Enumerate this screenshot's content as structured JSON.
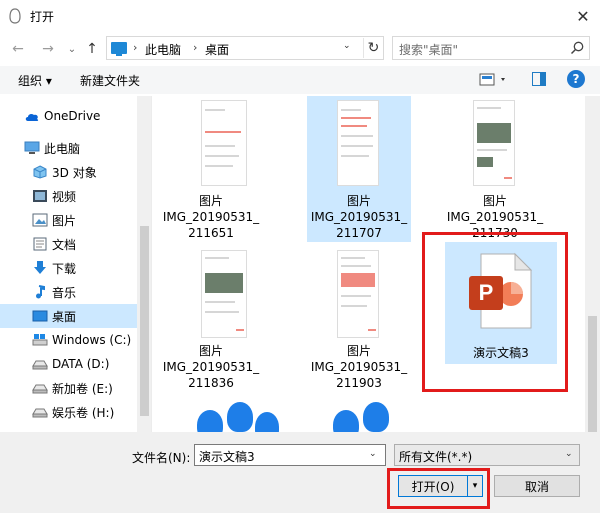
{
  "window": {
    "title": "打开",
    "close": "✕"
  },
  "nav": {
    "back": "←",
    "forward": "→",
    "recent": "⌄",
    "up": "↑",
    "sep": "›",
    "crumbs": [
      "此电脑",
      "桌面"
    ],
    "dropdown": "⌄",
    "refresh": "↻"
  },
  "search": {
    "placeholder": "搜索\"桌面\""
  },
  "toolbar": {
    "organize": "组织 ▾",
    "new_folder": "新建文件夹",
    "help": "?"
  },
  "sidebar": {
    "items": [
      {
        "label": "OneDrive",
        "icon": "cloud-icon"
      },
      {
        "label": "此电脑",
        "icon": "computer-icon"
      },
      {
        "label": "3D 对象",
        "icon": "cube-icon"
      },
      {
        "label": "视频",
        "icon": "video-icon"
      },
      {
        "label": "图片",
        "icon": "picture-icon"
      },
      {
        "label": "文档",
        "icon": "document-icon"
      },
      {
        "label": "下载",
        "icon": "download-icon"
      },
      {
        "label": "音乐",
        "icon": "music-icon"
      },
      {
        "label": "桌面",
        "icon": "desktop-icon",
        "selected": true
      },
      {
        "label": "Windows (C:)",
        "icon": "drive-icon"
      },
      {
        "label": "DATA (D:)",
        "icon": "drive-icon"
      },
      {
        "label": "新加卷 (E:)",
        "icon": "drive-icon"
      },
      {
        "label": "娱乐卷 (H:)",
        "icon": "drive-icon"
      }
    ]
  },
  "files": [
    {
      "line1": "图片",
      "line2": "IMG_20190531_",
      "line3": "211651"
    },
    {
      "line1": "图片",
      "line2": "IMG_20190531_",
      "line3": "211707"
    },
    {
      "line1": "图片",
      "line2": "IMG_20190531_",
      "line3": "211730"
    },
    {
      "line1": "图片",
      "line2": "IMG_20190531_",
      "line3": "211836"
    },
    {
      "line1": "图片",
      "line2": "IMG_20190531_",
      "line3": "211903"
    }
  ],
  "ppt_file": {
    "label": "演示文稿3",
    "letter": "P"
  },
  "bottom": {
    "filename_label": "文件名(N):",
    "filename_value": "演示文稿3",
    "filetype_value": "所有文件(*.*)",
    "open": "打开(O)",
    "open_dd": "▾",
    "cancel": "取消",
    "dd": "⌄"
  }
}
